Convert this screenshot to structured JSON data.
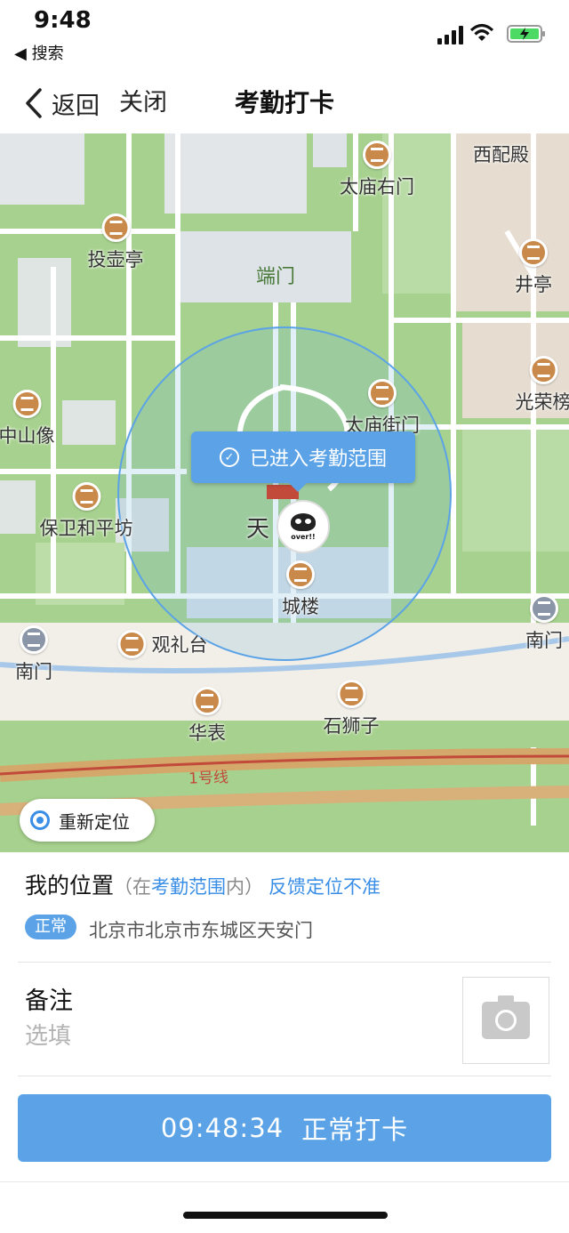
{
  "status_bar": {
    "time": "9:48",
    "back_app": "◀ 搜索"
  },
  "nav": {
    "back_label": "返回",
    "close_label": "关闭",
    "title": "考勤打卡"
  },
  "map": {
    "range_tip": "已进入考勤范围",
    "avatar_text": "over!!",
    "labels": {
      "taimiao_youmen": "太庙右门",
      "xipeidian": "西配殿",
      "touhuting": "投壶亭",
      "duanmen": "端门",
      "jingting": "井亭",
      "guangrong": "光荣榜",
      "taimiao_jiemen": "太庙街门",
      "zhongshanxiang": "中山像",
      "baowei": "保卫和平坊",
      "tian": "天",
      "chenglou": "城楼",
      "nanmen_left": "南门",
      "nanmen_right": "南门",
      "guanlitai": "观礼台",
      "huabiao": "华表",
      "shizi": "石狮子",
      "line1": "1号线"
    },
    "relocate_label": "重新定位"
  },
  "info": {
    "my_location": "我的位置",
    "range_prefix": "（在",
    "range_text": "考勤范围",
    "range_suffix": "内）",
    "feedback": "反馈定位不准",
    "badge": "正常",
    "address": "北京市北京市东城区天安门",
    "remark_title": "备注",
    "remark_placeholder": "选填",
    "punch_time": "09:48:34",
    "punch_label": "正常打卡"
  },
  "colors": {
    "accent": "#5ba3e6",
    "link": "#3a8ee6",
    "map_green": "#a7d18e",
    "poi_brown": "#c8894a"
  }
}
